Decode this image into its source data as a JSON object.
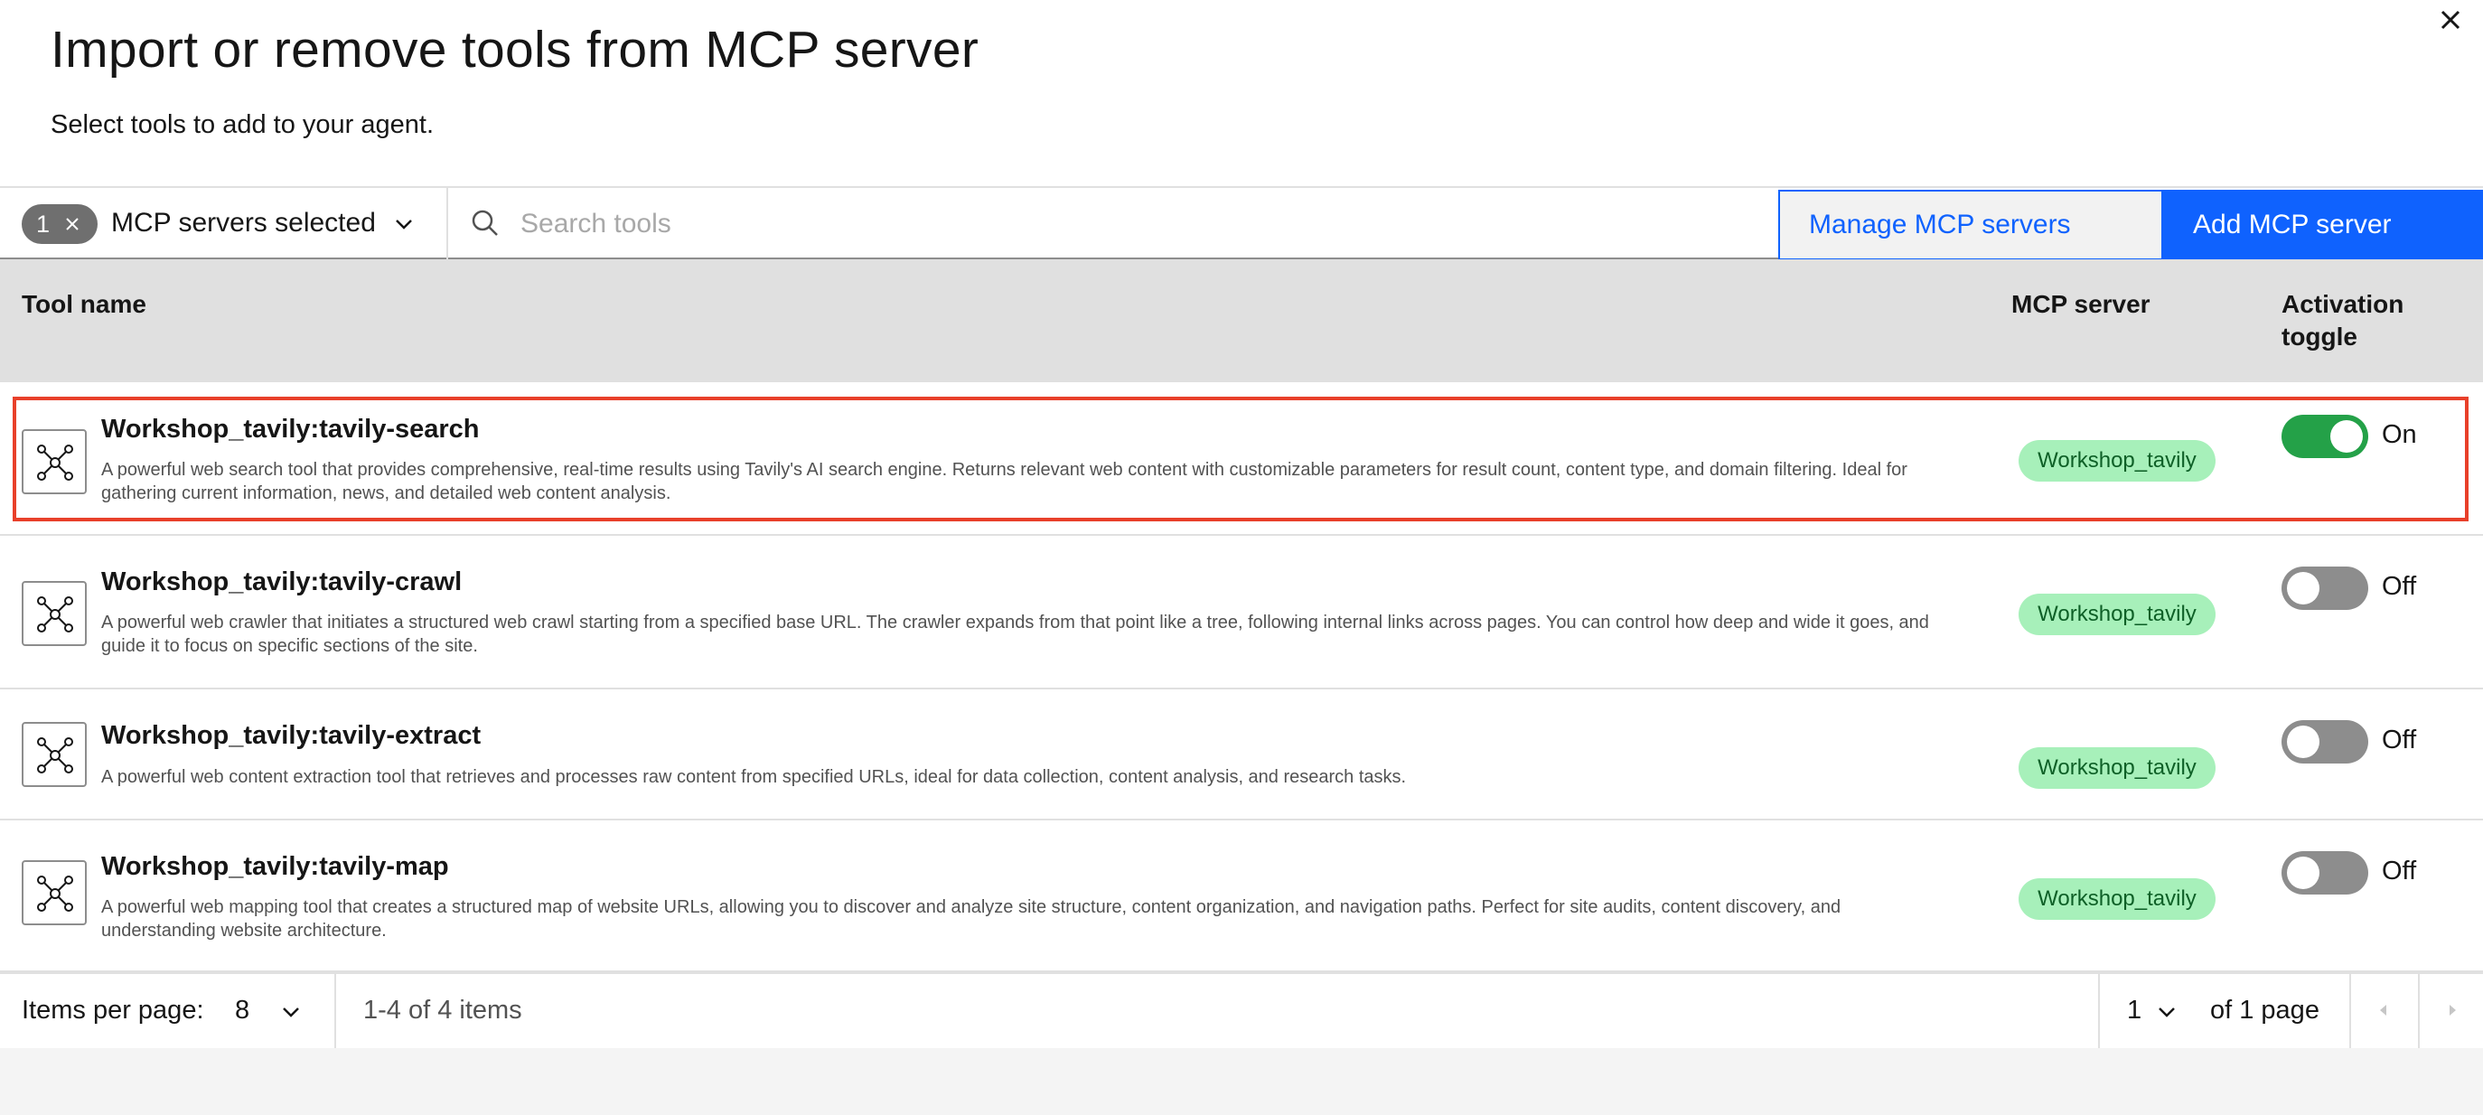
{
  "dialog": {
    "title": "Import or remove tools from MCP server",
    "subtitle": "Select tools to add to your agent.",
    "close_icon": "close-icon"
  },
  "toolbar": {
    "filter_count": "1",
    "filter_label": "MCP servers selected",
    "search_placeholder": "Search tools",
    "search_value": "",
    "manage_label": "Manage MCP servers",
    "add_label": "Add MCP server"
  },
  "table": {
    "headers": {
      "name": "Tool name",
      "server": "MCP server",
      "toggle": "Activation toggle"
    },
    "rows": [
      {
        "name": "Workshop_tavily:tavily-search",
        "description": "A powerful web search tool that provides comprehensive, real-time results using Tavily's AI search engine. Returns relevant web content with customizable parameters for result count, content type, and domain filtering. Ideal for gathering current information, news, and detailed web content analysis.",
        "server": "Workshop_tavily",
        "active": true,
        "toggle_label": "On",
        "selected": true
      },
      {
        "name": "Workshop_tavily:tavily-crawl",
        "description": "A powerful web crawler that initiates a structured web crawl starting from a specified base URL. The crawler expands from that point like a tree, following internal links across pages. You can control how deep and wide it goes, and guide it to focus on specific sections of the site.",
        "server": "Workshop_tavily",
        "active": false,
        "toggle_label": "Off",
        "selected": false
      },
      {
        "name": "Workshop_tavily:tavily-extract",
        "description": "A powerful web content extraction tool that retrieves and processes raw content from specified URLs, ideal for data collection, content analysis, and research tasks.",
        "server": "Workshop_tavily",
        "active": false,
        "toggle_label": "Off",
        "selected": false
      },
      {
        "name": "Workshop_tavily:tavily-map",
        "description": "A powerful web mapping tool that creates a structured map of website URLs, allowing you to discover and analyze site structure, content organization, and navigation paths. Perfect for site audits, content discovery, and understanding website architecture.",
        "server": "Workshop_tavily",
        "active": false,
        "toggle_label": "Off",
        "selected": false
      }
    ]
  },
  "pagination": {
    "items_per_page_label": "Items per page:",
    "items_per_page": "8",
    "range": "1-4 of 4 items",
    "page": "1",
    "of_pages": "of 1 page"
  },
  "colors": {
    "primary": "#0f62fe",
    "toggle_on": "#24a148",
    "toggle_off": "#8d8d8d",
    "server_tag_bg": "#a7f0ba",
    "server_tag_text": "#0e6027",
    "highlight": "#e8402a"
  }
}
